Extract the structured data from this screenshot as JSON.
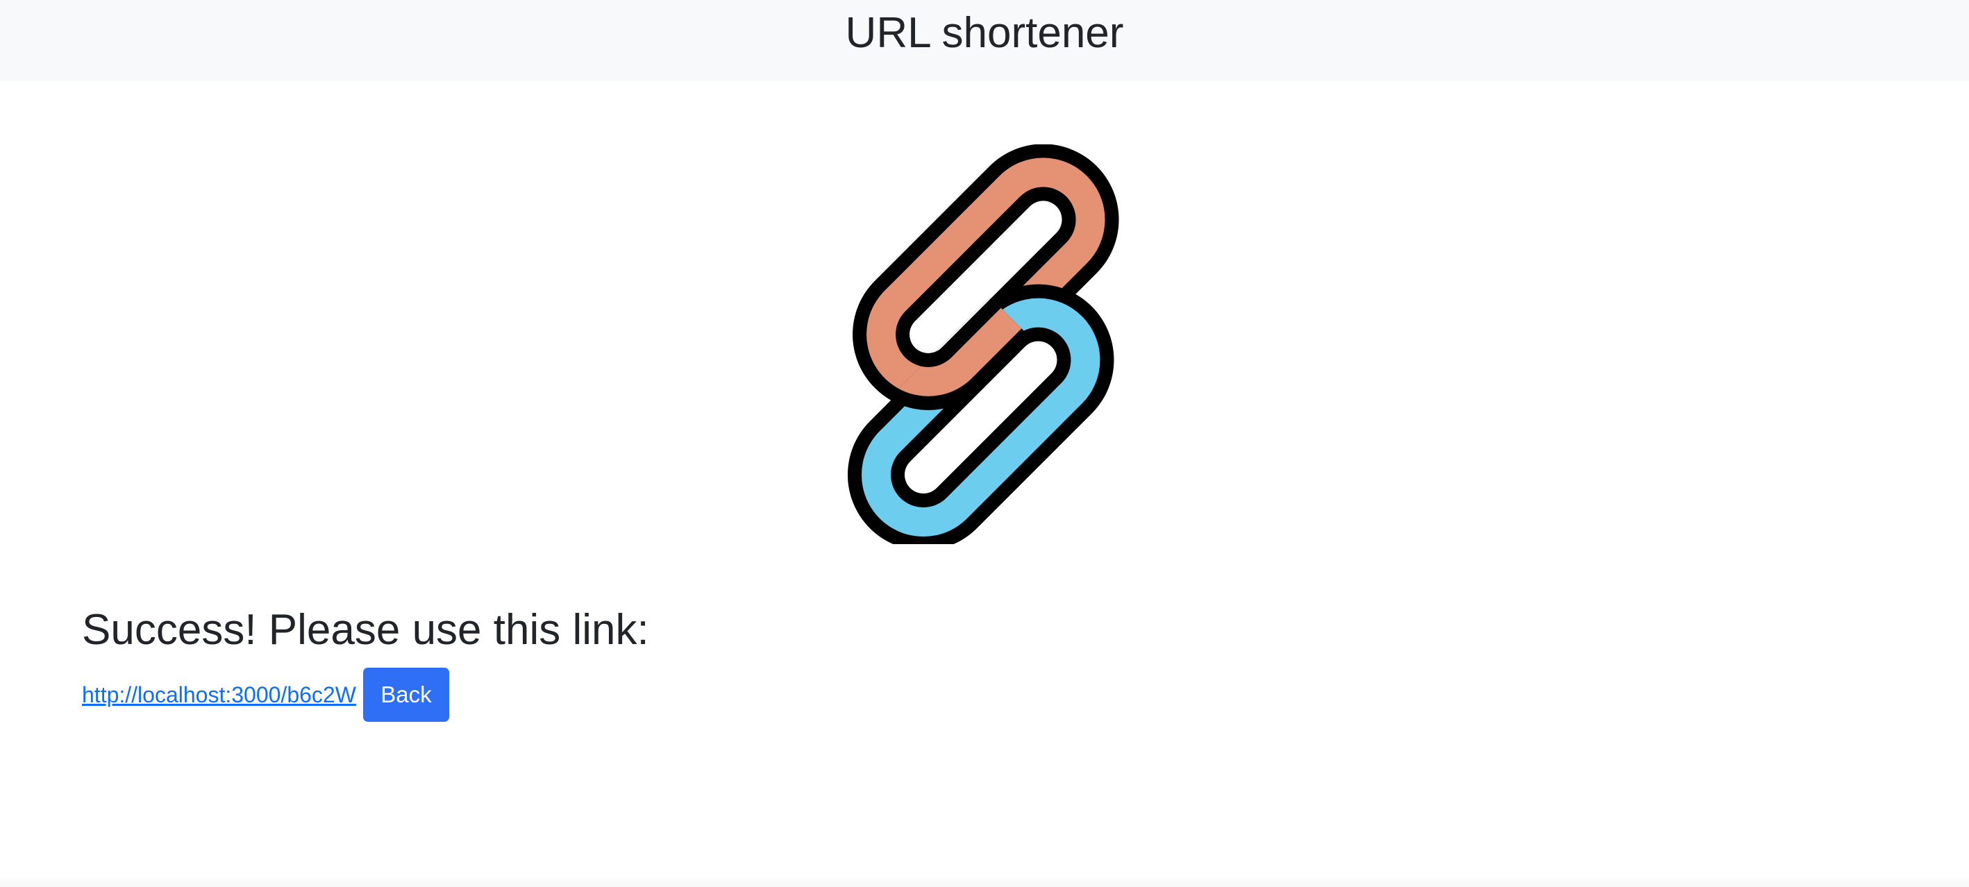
{
  "header": {
    "title": "URL shortener"
  },
  "logo": {
    "icon": "chain-link-icon",
    "colors": {
      "back_link": "#e59174",
      "front_link": "#6ccdee",
      "outline": "#000000"
    }
  },
  "result": {
    "heading": "Success! Please use this link:",
    "short_url": "http://localhost:3000/b6c2W",
    "back_label": "Back"
  },
  "colors": {
    "header_bg": "#f8f9fa",
    "link": "#0d6efd",
    "button_bg": "#2f6ff6",
    "button_text": "#ffffff",
    "text": "#212529"
  }
}
